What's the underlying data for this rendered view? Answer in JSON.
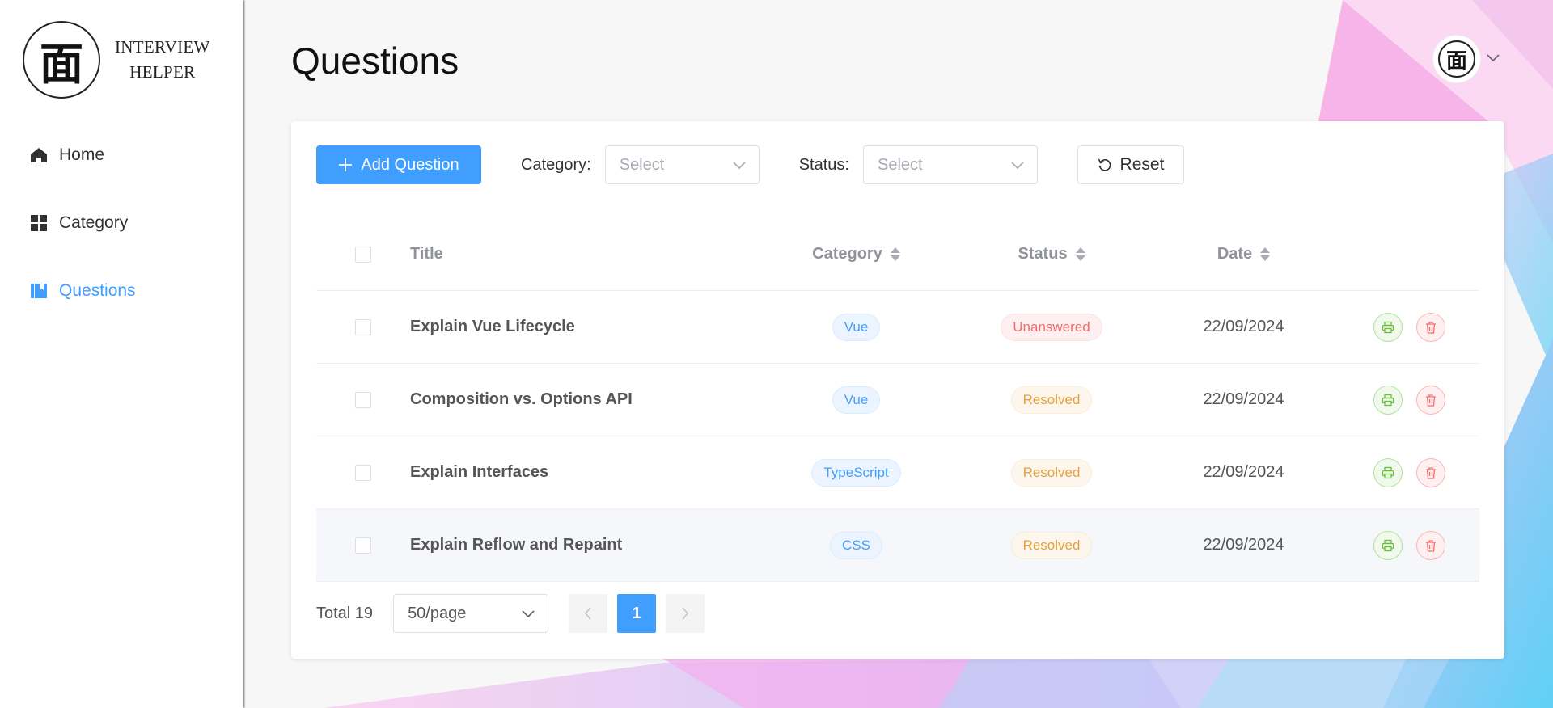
{
  "sidebar": {
    "logo_glyph": "面",
    "logo_line1": "INTERVIEW",
    "logo_line2": "HELPER",
    "items": [
      {
        "label": "Home",
        "icon": "home-icon",
        "active": false
      },
      {
        "label": "Category",
        "icon": "grid-icon",
        "active": false
      },
      {
        "label": "Questions",
        "icon": "book-icon",
        "active": true
      }
    ]
  },
  "header": {
    "title": "Questions",
    "avatar_glyph": "面"
  },
  "toolbar": {
    "add_label": "Add Question",
    "category_label": "Category:",
    "category_placeholder": "Select",
    "status_label": "Status:",
    "status_placeholder": "Select",
    "reset_label": "Reset"
  },
  "table": {
    "columns": {
      "title": "Title",
      "category": "Category",
      "status": "Status",
      "date": "Date"
    },
    "rows": [
      {
        "title": "Explain Vue Lifecycle",
        "category": "Vue",
        "status": "Unanswered",
        "status_type": "red",
        "date": "22/09/2024"
      },
      {
        "title": "Composition vs. Options API",
        "category": "Vue",
        "status": "Resolved",
        "status_type": "orange",
        "date": "22/09/2024"
      },
      {
        "title": "Explain Interfaces",
        "category": "TypeScript",
        "status": "Resolved",
        "status_type": "orange",
        "date": "22/09/2024"
      },
      {
        "title": "Explain Reflow and Repaint",
        "category": "CSS",
        "status": "Resolved",
        "status_type": "orange",
        "date": "22/09/2024"
      }
    ]
  },
  "pagination": {
    "total_label": "Total 19",
    "page_size": "50/page",
    "current_page": "1"
  },
  "colors": {
    "primary": "#409eff",
    "danger": "#f56c6c",
    "warning": "#e6a23c",
    "success": "#67c23a"
  }
}
